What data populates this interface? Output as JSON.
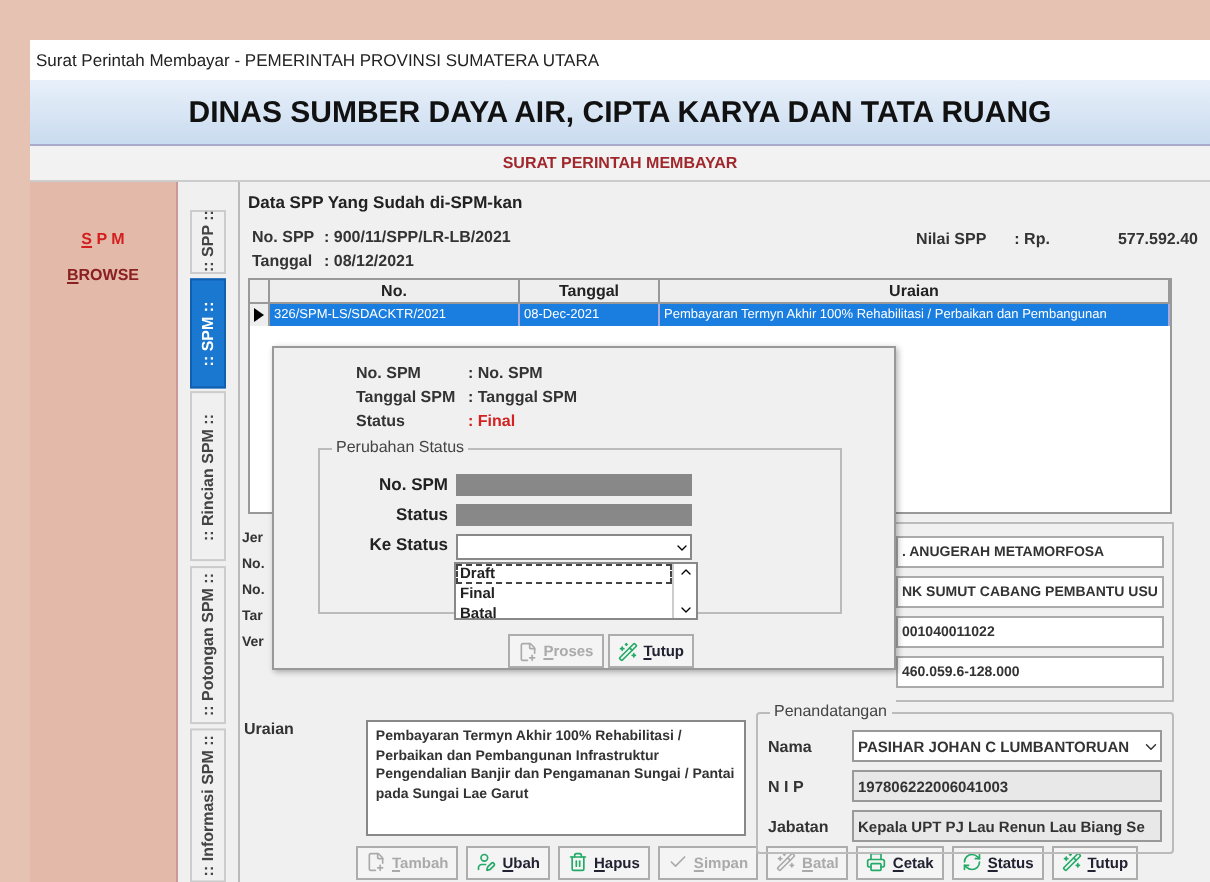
{
  "window": {
    "title": "Surat Perintah Membayar - PEMERINTAH PROVINSI SUMATERA UTARA"
  },
  "header": {
    "title": "DINAS SUMBER DAYA AIR, CIPTA KARYA DAN TATA RUANG",
    "subtitle": "SURAT PERINTAH MEMBAYAR"
  },
  "sidebar": {
    "items": [
      {
        "label": "S P M",
        "selected": true
      },
      {
        "label": "BROWSE",
        "selected": false
      }
    ]
  },
  "side_tabs": [
    {
      "label": ":: SPP ::",
      "selected": false
    },
    {
      "label": ":: SPM ::",
      "selected": true
    },
    {
      "label": ":: Rincian SPM ::",
      "selected": false
    },
    {
      "label": ":: Potongan SPM ::",
      "selected": false
    },
    {
      "label": ":: Informasi SPM ::",
      "selected": false
    }
  ],
  "spp_group": {
    "title": "Data SPP Yang Sudah di-SPM-kan",
    "fields": [
      {
        "label": "No. SPP",
        "value": ": 900/11/SPP/LR-LB/2021"
      },
      {
        "label": "Tanggal",
        "value": ": 08/12/2021"
      }
    ],
    "total": {
      "label": "Nilai SPP",
      "currency": ": Rp.",
      "value": "577.592.40"
    }
  },
  "table": {
    "columns": [
      "No.",
      "Tanggal",
      "Uraian"
    ],
    "rows": [
      {
        "cells": [
          "326/SPM-LS/SDACKTR/2021",
          "08-Dec-2021",
          "Pembayaran Termyn Akhir 100% Rehabilitasi / Perbaikan dan Pembangunan"
        ],
        "selected": true
      }
    ]
  },
  "form": {
    "labels": [
      "Jer",
      "No.",
      "No.",
      "Tar",
      "Ver"
    ],
    "fields": [
      ". ANUGERAH METAMORFOSA",
      "NK SUMUT CABANG PEMBANTU USU",
      "001040011022",
      "460.059.6-128.000"
    ],
    "uraian": {
      "label": "Uraian",
      "value": "Pembayaran Termyn Akhir 100% Rehabilitasi / Perbaikan dan Pembangunan Infrastruktur Pengendalian Banjir dan Pengamanan Sungai / Pantai pada Sungai Lae Garut"
    },
    "signer": {
      "title": "Penandatangan",
      "fields": [
        {
          "label": "Nama",
          "value": "PASIHAR JOHAN C LUMBANTORUAN",
          "kind": "dropdown"
        },
        {
          "label": "N I P",
          "value": "197806222006041003",
          "kind": "readonly"
        },
        {
          "label": "Jabatan",
          "value": "Kepala UPT PJ Lau Renun Lau Biang Se",
          "kind": "readonly"
        }
      ]
    }
  },
  "buttons": [
    {
      "label": "Tambah",
      "disabled": true
    },
    {
      "label": "Ubah",
      "disabled": false
    },
    {
      "label": "Hapus",
      "disabled": false
    },
    {
      "label": "Simpan",
      "disabled": true
    },
    {
      "label": "Batal",
      "disabled": true
    },
    {
      "label": "Cetak",
      "disabled": false
    },
    {
      "label": "Status",
      "disabled": false
    },
    {
      "label": "Tutup",
      "disabled": false
    }
  ],
  "dialog": {
    "info": [
      {
        "label": "No. SPM",
        "value": ": No. SPM",
        "kind": "plain"
      },
      {
        "label": "Tanggal SPM",
        "value": ": Tanggal SPM",
        "kind": "plain"
      },
      {
        "label": "Status",
        "value": ": Final",
        "kind": "alert"
      }
    ],
    "group": {
      "title": "Perubahan Status",
      "fields": [
        {
          "label": "No. SPM",
          "kind": "readonly"
        },
        {
          "label": "Status",
          "kind": "readonly"
        },
        {
          "label": "Ke Status",
          "kind": "dropdown"
        }
      ]
    },
    "options": [
      {
        "label": "Draft",
        "selected": true
      },
      {
        "label": "Final",
        "selected": false
      },
      {
        "label": "Batal",
        "selected": false
      }
    ],
    "buttons": [
      {
        "label": "Proses",
        "disabled": true
      },
      {
        "label": "Tutup",
        "disabled": false
      }
    ]
  }
}
